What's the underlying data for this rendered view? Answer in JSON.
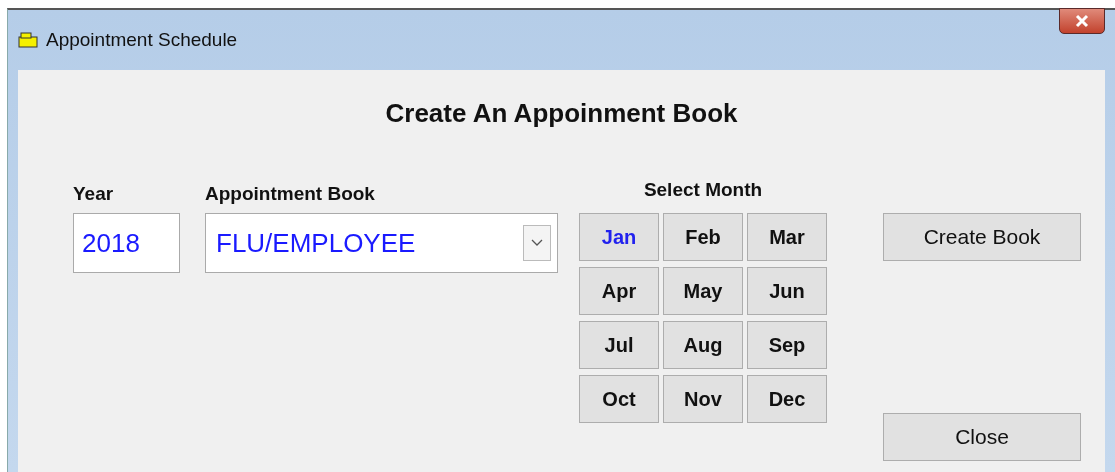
{
  "window": {
    "title": "Appointment Schedule"
  },
  "heading": "Create An Appoinment Book",
  "year": {
    "label": "Year",
    "value": "2018"
  },
  "book": {
    "label": "Appointment Book",
    "value": "FLU/EMPLOYEE"
  },
  "months": {
    "label": "Select Month",
    "items": [
      {
        "label": "Jan",
        "selected": true
      },
      {
        "label": "Feb",
        "selected": false
      },
      {
        "label": "Mar",
        "selected": false
      },
      {
        "label": "Apr",
        "selected": false
      },
      {
        "label": "May",
        "selected": false
      },
      {
        "label": "Jun",
        "selected": false
      },
      {
        "label": "Jul",
        "selected": false
      },
      {
        "label": "Aug",
        "selected": false
      },
      {
        "label": "Sep",
        "selected": false
      },
      {
        "label": "Oct",
        "selected": false
      },
      {
        "label": "Nov",
        "selected": false
      },
      {
        "label": "Dec",
        "selected": false
      }
    ]
  },
  "buttons": [
    "Create Book",
    "Close"
  ]
}
